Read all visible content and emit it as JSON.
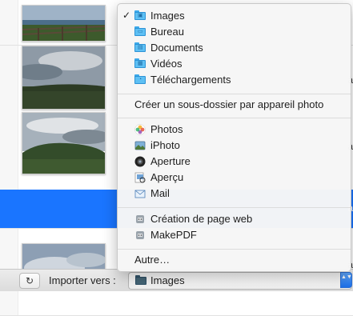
{
  "list": {
    "row_tail_char": "à"
  },
  "bottom_bar": {
    "import_label": "Importer vers :",
    "popup_value": "Images",
    "popup_arrows": "▲▼",
    "rotate_symbol": "↻"
  },
  "menu": {
    "checkmark": "✓",
    "folders": [
      {
        "label": "Images",
        "icon": "images-folder-icon",
        "checked": true
      },
      {
        "label": "Bureau",
        "icon": "desktop-folder-icon"
      },
      {
        "label": "Documents",
        "icon": "documents-folder-icon"
      },
      {
        "label": "Vidéos",
        "icon": "videos-folder-icon"
      },
      {
        "label": "Téléchargements",
        "icon": "downloads-folder-icon"
      }
    ],
    "subfolder_option": "Créer un sous-dossier par appareil photo",
    "apps": [
      {
        "label": "Photos",
        "icon": "photos-app-icon"
      },
      {
        "label": "iPhoto",
        "icon": "iphoto-app-icon"
      },
      {
        "label": "Aperture",
        "icon": "aperture-app-icon"
      },
      {
        "label": "Aperçu",
        "icon": "preview-app-icon"
      },
      {
        "label": "Mail",
        "icon": "mail-app-icon"
      }
    ],
    "automator": [
      {
        "label": "Création de page web",
        "icon": "automator-icon"
      },
      {
        "label": "MakePDF",
        "icon": "automator-icon"
      }
    ],
    "other": "Autre…"
  },
  "colors": {
    "selection": "#1a75ff",
    "folder": "#5ec0f4",
    "accent": "#1c6fe8"
  }
}
